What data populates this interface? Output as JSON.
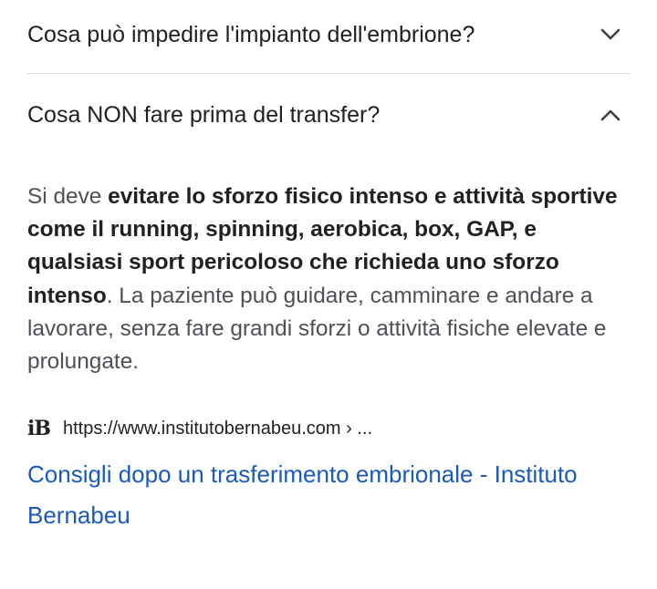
{
  "faq": [
    {
      "question": "Cosa può impedire l'impianto dell'embrione?",
      "expanded": false,
      "icon": "chevron-down-icon"
    },
    {
      "question": "Cosa NON fare prima del transfer?",
      "expanded": true,
      "icon": "chevron-up-icon"
    }
  ],
  "answer": {
    "intro": "Si deve ",
    "bold": "evitare lo sforzo fisico intenso e attività sportive come il running, spinning, aerobica, box, GAP, e qualsiasi sport pericoloso che richieda uno sforzo intenso",
    "rest": ". La paziente può guidare, camminare e andare a lavorare, senza fare grandi sforzi o attività fisiche elevate e prolungate."
  },
  "source": {
    "favicon_text": "iB",
    "url": "https://www.institutobernabeu.com › ...",
    "title": "Consigli dopo un trasferimento embrionale - Instituto Bernabeu"
  },
  "colors": {
    "link": "#1a5ab8",
    "text": "#202124",
    "muted": "#4d5156",
    "divider": "#dadce0"
  }
}
